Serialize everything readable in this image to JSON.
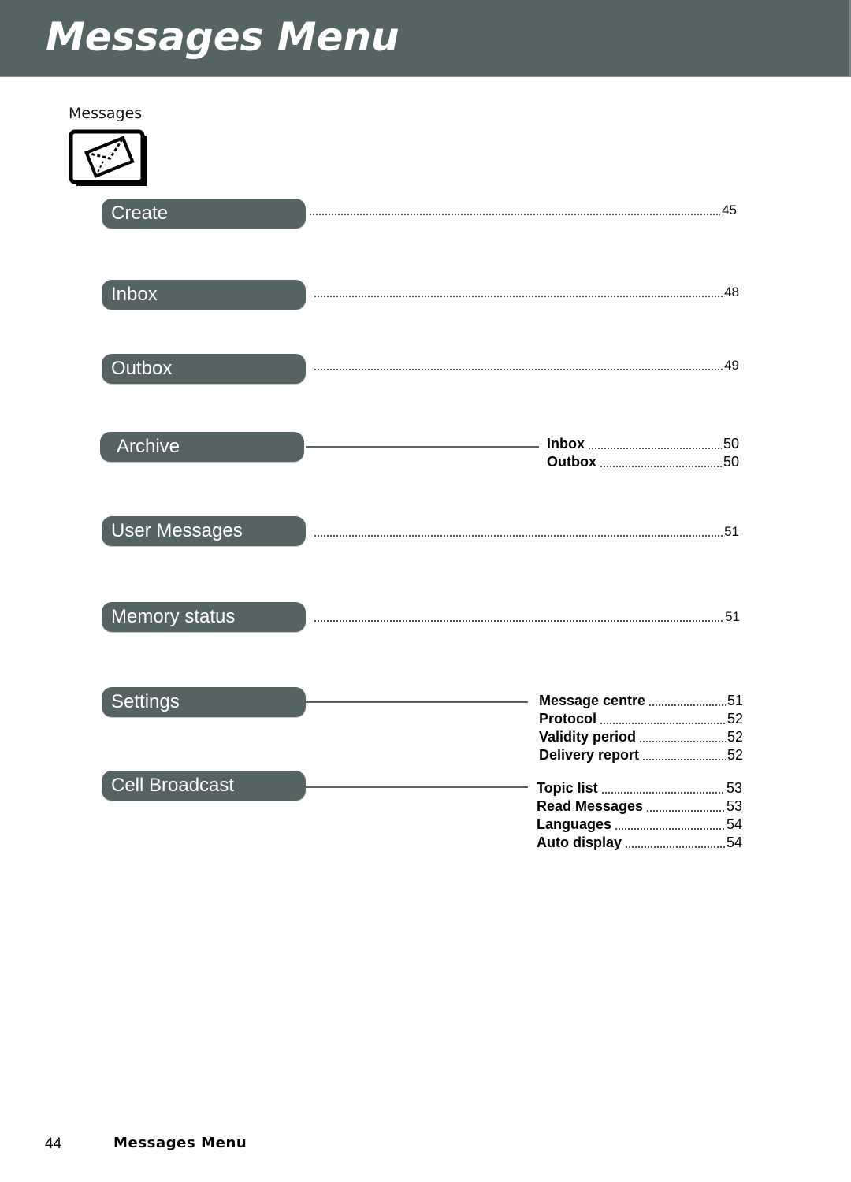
{
  "header": {
    "title": "Messages Menu",
    "background_color": "#566363"
  },
  "section": {
    "label": "Messages",
    "icon": "envelope-icon"
  },
  "menu": [
    {
      "label": "Create",
      "page": "45"
    },
    {
      "label": "Inbox",
      "page": "48"
    },
    {
      "label": "Outbox",
      "page": "49"
    },
    {
      "label": "Archive",
      "submenu": [
        {
          "label": "Inbox",
          "page": "50"
        },
        {
          "label": "Outbox",
          "page": "50"
        }
      ]
    },
    {
      "label": "User Messages",
      "page": "51"
    },
    {
      "label": "Memory status",
      "page": "51"
    },
    {
      "label": "Settings",
      "submenu": [
        {
          "label": "Message centre",
          "page": "51"
        },
        {
          "label": "Protocol",
          "page": "52"
        },
        {
          "label": "Validity period",
          "page": "52"
        },
        {
          "label": "Delivery report",
          "page": "52"
        }
      ]
    },
    {
      "label": "Cell Broadcast",
      "submenu": [
        {
          "label": "Topic list",
          "page": "53"
        },
        {
          "label": "Read Messages",
          "page": "53"
        },
        {
          "label": "Languages",
          "page": "54"
        },
        {
          "label": "Auto display",
          "page": "54"
        }
      ]
    }
  ],
  "footer": {
    "page_number": "44",
    "title": "Messages Menu"
  }
}
